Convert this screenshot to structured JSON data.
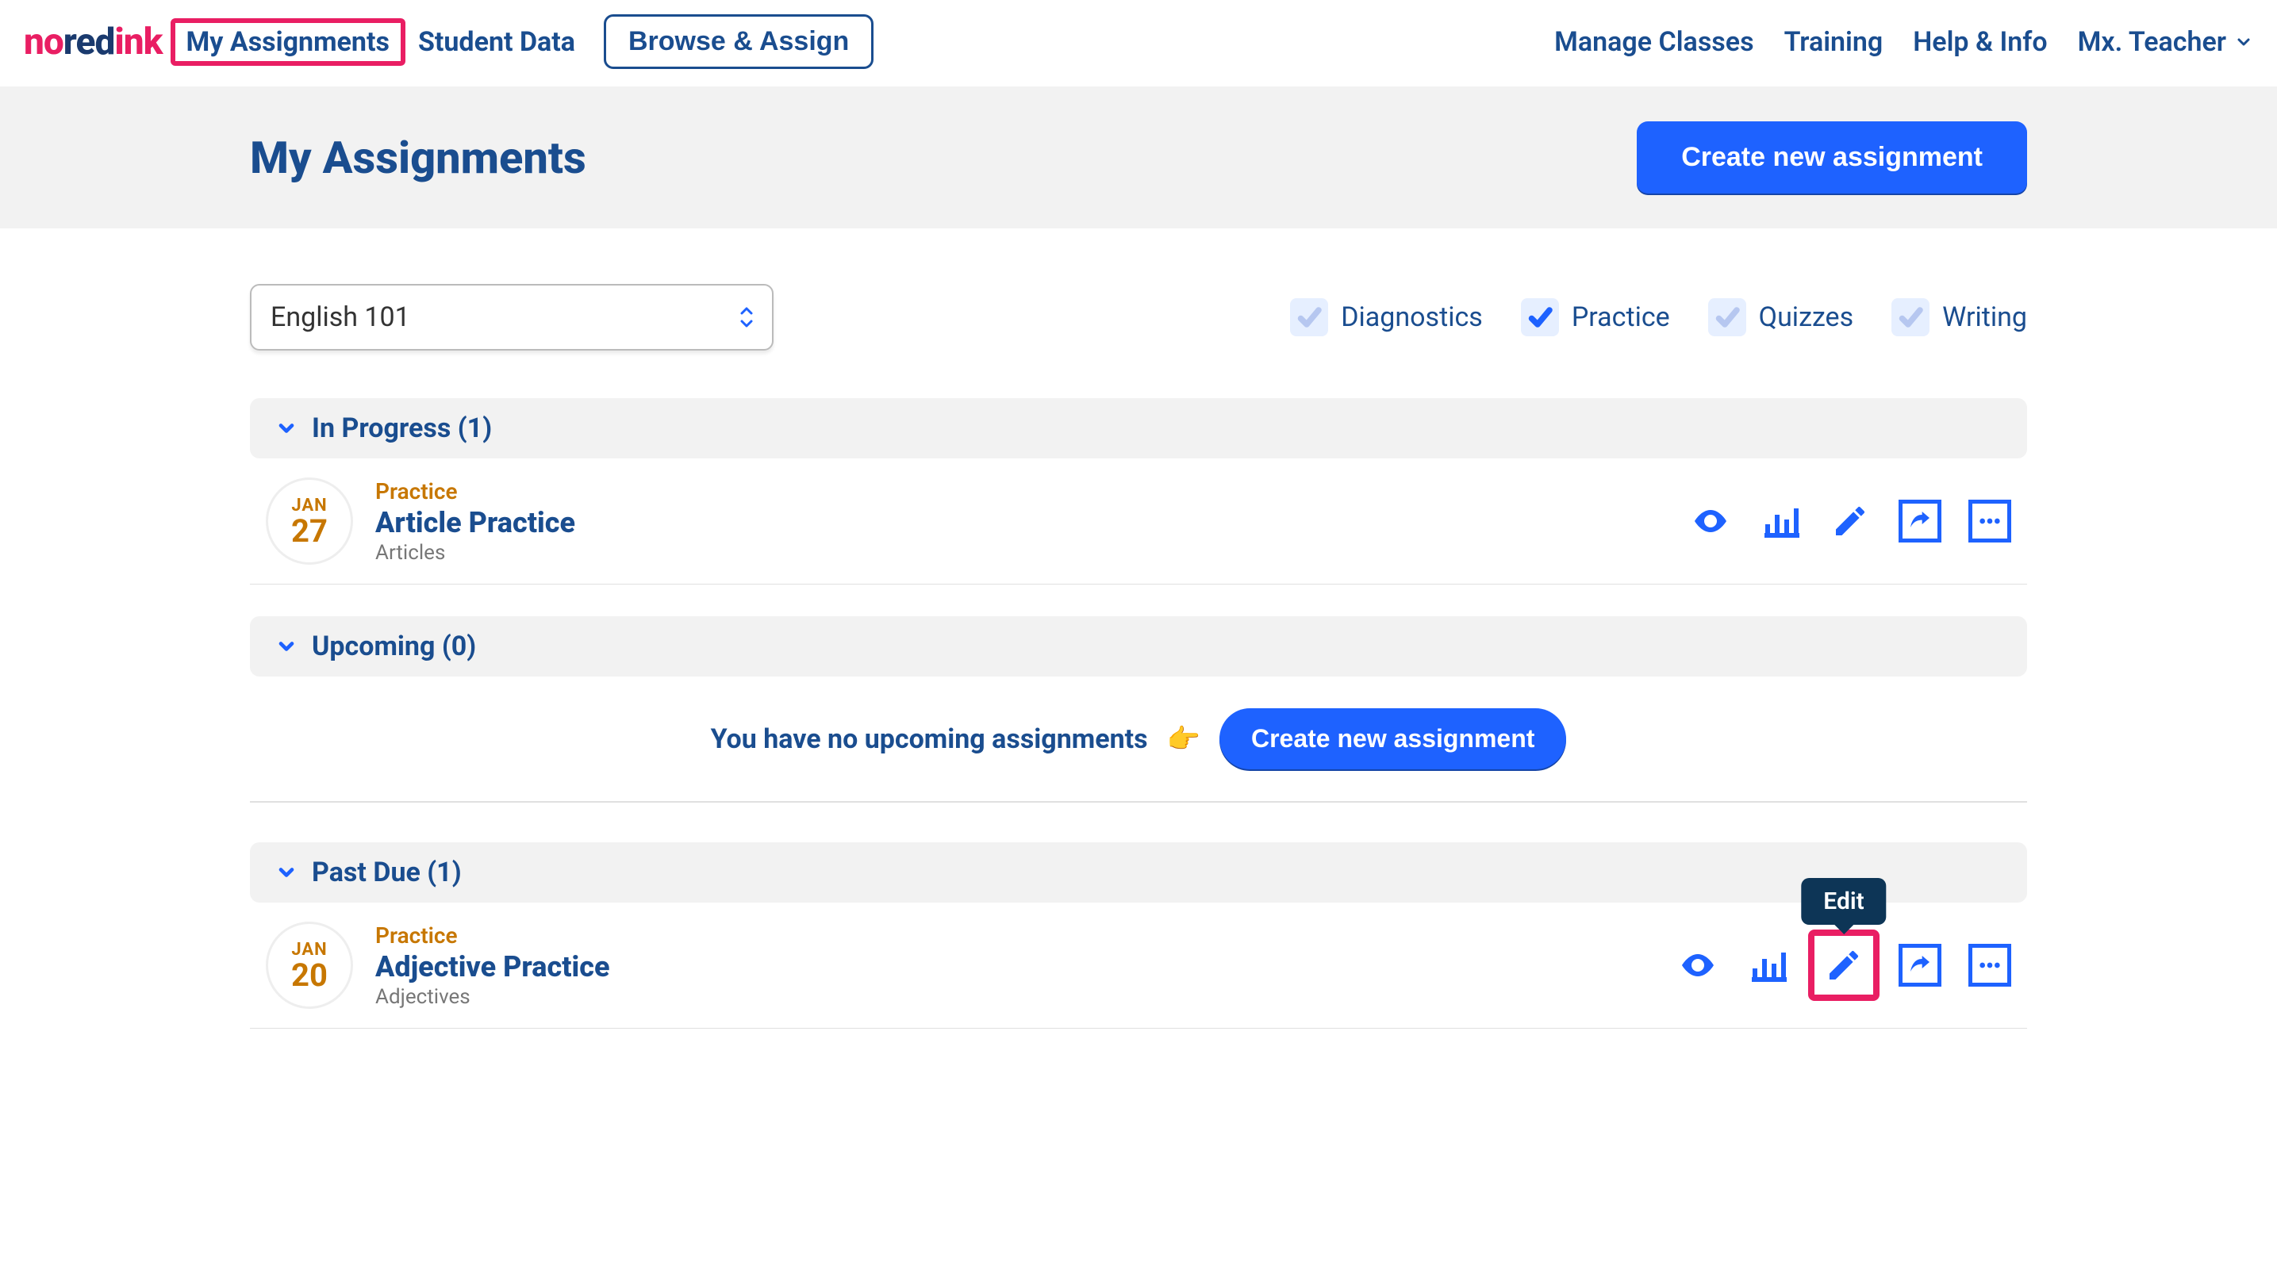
{
  "logo": {
    "part1": "no",
    "part2": "red",
    "part3": "ink"
  },
  "nav": {
    "my_assignments": "My Assignments",
    "student_data": "Student Data",
    "browse_assign": "Browse & Assign",
    "manage_classes": "Manage Classes",
    "training": "Training",
    "help_info": "Help & Info",
    "user": "Mx. Teacher"
  },
  "page": {
    "title": "My Assignments",
    "create_btn": "Create new assignment"
  },
  "class_select": {
    "selected": "English 101"
  },
  "filters": {
    "diagnostics": "Diagnostics",
    "practice": "Practice",
    "quizzes": "Quizzes",
    "writing": "Writing"
  },
  "sections": {
    "in_progress": {
      "label": "In Progress (1)"
    },
    "upcoming": {
      "label": "Upcoming (0)",
      "empty_text": "You have no upcoming assignments",
      "emoji": "👉",
      "cta": "Create new assignment"
    },
    "past_due": {
      "label": "Past Due (1)"
    }
  },
  "assignments": {
    "in_progress": [
      {
        "month": "JAN",
        "day": "27",
        "type": "Practice",
        "title": "Article Practice",
        "subtitle": "Articles"
      }
    ],
    "past_due": [
      {
        "month": "JAN",
        "day": "20",
        "type": "Practice",
        "title": "Adjective Practice",
        "subtitle": "Adjectives"
      }
    ]
  },
  "tooltip": {
    "edit": "Edit"
  }
}
